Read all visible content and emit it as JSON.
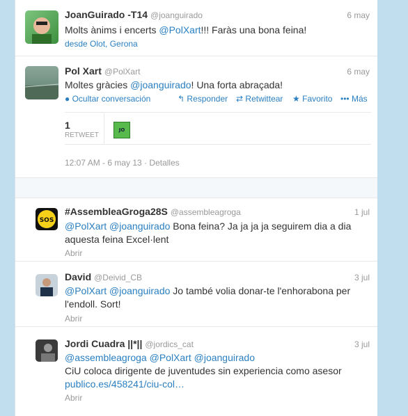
{
  "tweets": [
    {
      "name": "JoanGuirado -T14",
      "handle": "@joanguirado",
      "date": "6 may",
      "text_pre": "Molts ànims i encerts ",
      "mention": "@PolXart",
      "text_post": "!!! Faràs una bona feina!",
      "location": "desde Olot, Gerona"
    },
    {
      "name": "Pol Xart",
      "handle": "@PolXart",
      "date": "6 may",
      "text_pre": "Moltes gràcies ",
      "mention": "@joanguirado",
      "text_post": "! Una forta abraçada!",
      "actions": {
        "hide": "Ocultar conversación",
        "reply": "Responder",
        "retweet": "Retwittear",
        "favorite": "Favorito",
        "more": "Más"
      },
      "retweet_count": "1",
      "retweet_label": "RETWEET",
      "timestamp": "12:07 AM - 6 may 13",
      "details_label": "Detalles"
    }
  ],
  "replies": [
    {
      "name": "#AssembleaGroga28S",
      "handle": "@assembleagroga",
      "date": "1 jul",
      "mentions": "@PolXart @joanguirado",
      "text": " Bona feina? Ja ja ja ja seguirem dia a dia",
      "text2": "aquesta feina Excel·lent",
      "open": "Abrir"
    },
    {
      "name": "David",
      "handle": "@Deivid_CB",
      "date": "3 jul",
      "mentions": "@PolXart @joanguirado",
      "text": " Jo també volia donar-te l'enhorabona per",
      "text2": "l'endoll. Sort!",
      "open": "Abrir"
    },
    {
      "name": "Jordi Cuadra ||*||",
      "handle": "@jordics_cat",
      "date": "3 jul",
      "mentions": "@assembleagroga @PolXart @joanguirado",
      "text": "CiU coloca dirigente de juventudes sin experiencia como asesor",
      "link": "publico.es/458241/ciu-col…",
      "open": "Abrir"
    }
  ],
  "colors": {
    "link": "#2a7fc1",
    "background": "#c0deed"
  },
  "avatar_badge": "JO"
}
